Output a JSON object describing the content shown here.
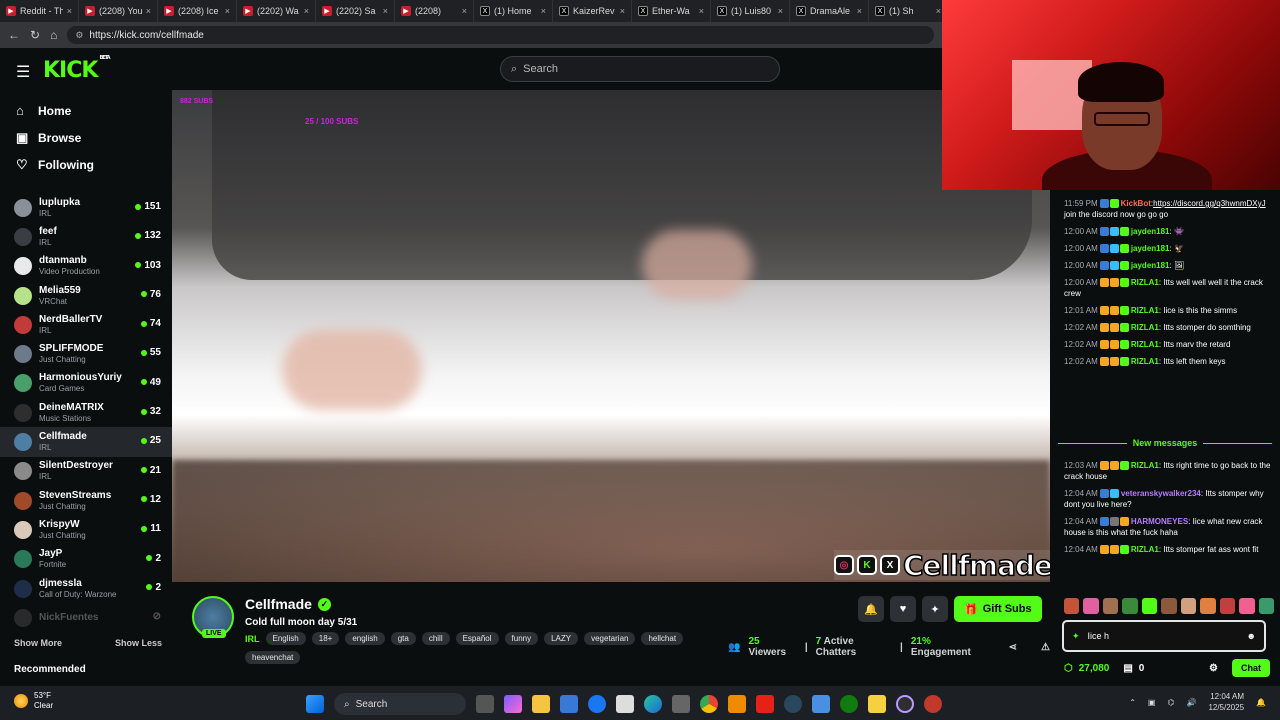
{
  "browser": {
    "tabs": [
      {
        "label": "Reddit - Th",
        "icon": "reddit-icon"
      },
      {
        "label": "(2208) You",
        "icon": "youtube-icon"
      },
      {
        "label": "(2208) Ice",
        "icon": "youtube-icon"
      },
      {
        "label": "(2202) Wa",
        "icon": "youtube-icon"
      },
      {
        "label": "(2202) Sa",
        "icon": "youtube-icon"
      },
      {
        "label": "(2208)",
        "icon": "youtube-icon"
      },
      {
        "label": "(1) Home",
        "icon": "x-icon"
      },
      {
        "label": "KaizerRev",
        "icon": "x-icon"
      },
      {
        "label": "Ether-Wa",
        "icon": "x-icon"
      },
      {
        "label": "(1) Luis80",
        "icon": "x-icon"
      },
      {
        "label": "DramaAle",
        "icon": "x-icon"
      },
      {
        "label": "(1) Sh",
        "icon": "x-icon"
      }
    ],
    "url": "https://kick.com/cellfmade"
  },
  "header": {
    "logo": "KICK",
    "logo_badge": "BETA",
    "search_placeholder": "Search"
  },
  "sidebar": {
    "nav": [
      {
        "label": "Home",
        "icon": "home-icon",
        "glyph": "⌂"
      },
      {
        "label": "Browse",
        "icon": "browse-icon",
        "glyph": "▣"
      },
      {
        "label": "Following",
        "icon": "heart-icon",
        "glyph": "♡"
      }
    ],
    "channels": [
      {
        "name": "luplupka",
        "category": "IRL",
        "viewers": "151",
        "color": "#8a8f9a"
      },
      {
        "name": "feef",
        "category": "IRL",
        "viewers": "132",
        "color": "#3a3d44"
      },
      {
        "name": "dtanmanb",
        "category": "Video Production",
        "viewers": "103",
        "color": "#e9e9e9"
      },
      {
        "name": "Melia559",
        "category": "VRChat",
        "viewers": "76",
        "color": "#b6e38a"
      },
      {
        "name": "NerdBallerTV",
        "category": "IRL",
        "viewers": "74",
        "color": "#c23b3b"
      },
      {
        "name": "SPLIFFMODE",
        "category": "Just Chatting",
        "viewers": "55",
        "color": "#6c7a8a"
      },
      {
        "name": "HarmoniousYuriy",
        "category": "Card Games",
        "viewers": "49",
        "color": "#4a9e6b"
      },
      {
        "name": "DeineMATRIX",
        "category": "Music Stations",
        "viewers": "32",
        "color": "#2e2e2e"
      },
      {
        "name": "Cellfmade",
        "category": "IRL",
        "viewers": "25",
        "color": "#4e7ea3"
      },
      {
        "name": "SilentDestroyer",
        "category": "IRL",
        "viewers": "21",
        "color": "#8a8a8a"
      },
      {
        "name": "StevenStreams",
        "category": "Just Chatting",
        "viewers": "12",
        "color": "#a04a2a"
      },
      {
        "name": "KrispyW",
        "category": "Just Chatting",
        "viewers": "11",
        "color": "#d9c9b9"
      },
      {
        "name": "JayP",
        "category": "Fortnite",
        "viewers": "2",
        "color": "#2a7a5a"
      },
      {
        "name": "djmessla",
        "category": "Call of Duty: Warzone",
        "viewers": "2",
        "color": "#1e2d4a"
      },
      {
        "name": "NickFuentes",
        "category": "",
        "viewers": "",
        "color": "#555555"
      }
    ],
    "show_more": "Show More",
    "show_less": "Show Less",
    "recommended": "Recommended"
  },
  "video": {
    "overlay_top": "882 SUBS",
    "overlay_goal": "25 / 100 SUBS",
    "watermark": "Cellfmade"
  },
  "stream": {
    "name": "Cellfmade",
    "live_label": "LIVE",
    "title": "Cold full moon day 5/31",
    "category": "IRL",
    "tags": [
      "English",
      "18+",
      "english",
      "gta",
      "chill",
      "Español",
      "funny",
      "LAZY",
      "vegetarian",
      "hellchat",
      "heavenchat"
    ],
    "gift_label": "Gift Subs",
    "viewers": "25",
    "viewers_label": "Viewers",
    "chatters": "7",
    "chatters_label": "Active Chatters",
    "engagement": "21%",
    "engagement_label": "Engagement"
  },
  "chat": {
    "messages": [
      {
        "time": "11:59 PM",
        "user": "KickBot",
        "color": "#ff6b57",
        "text": "",
        "link": "https://discord.gg/q3hwnmDXyJ",
        "after": " join the discord now go go go",
        "badges": [
          "#3a7bd5",
          "#53fc18"
        ]
      },
      {
        "time": "12:00 AM",
        "user": "jayden181",
        "color": "#53fc18",
        "text": " 👾",
        "badges": [
          "#3a7bd5",
          "#38bdf8",
          "#53fc18"
        ]
      },
      {
        "time": "12:00 AM",
        "user": "jayden181",
        "color": "#53fc18",
        "text": " 🦅",
        "badges": [
          "#3a7bd5",
          "#38bdf8",
          "#53fc18"
        ]
      },
      {
        "time": "12:00 AM",
        "user": "jayden181",
        "color": "#53fc18",
        "text": " 🖼",
        "badges": [
          "#3a7bd5",
          "#38bdf8",
          "#53fc18"
        ]
      },
      {
        "time": "12:00 AM",
        "user": "RIZLA1",
        "color": "#53fc18",
        "text": " Itts well well well it the crack crew",
        "badges": [
          "#f5a623",
          "#f5a623",
          "#53fc18"
        ]
      },
      {
        "time": "12:01 AM",
        "user": "RIZLA1",
        "color": "#53fc18",
        "text": " Iice is this the simms",
        "badges": [
          "#f5a623",
          "#f5a623",
          "#53fc18"
        ]
      },
      {
        "time": "12:02 AM",
        "user": "RIZLA1",
        "color": "#53fc18",
        "text": " Itts stomper do somthing",
        "badges": [
          "#f5a623",
          "#f5a623",
          "#53fc18"
        ]
      },
      {
        "time": "12:02 AM",
        "user": "RIZLA1",
        "color": "#53fc18",
        "text": " Itts marv the retard",
        "badges": [
          "#f5a623",
          "#f5a623",
          "#53fc18"
        ]
      },
      {
        "time": "12:02 AM",
        "user": "RIZLA1",
        "color": "#53fc18",
        "text": " Itts left them keys",
        "badges": [
          "#f5a623",
          "#f5a623",
          "#53fc18"
        ]
      }
    ],
    "new_messages_label": "New messages",
    "new_messages": [
      {
        "time": "12:03 AM",
        "user": "RIZLA1",
        "color": "#53fc18",
        "text": " Itts right time to go back to the crack house",
        "badges": [
          "#f5a623",
          "#f5a623",
          "#53fc18"
        ]
      },
      {
        "time": "12:04 AM",
        "user": "veteranskywalker234",
        "color": "#b67bff",
        "text": " Itts stomper why dont you live here?",
        "badges": [
          "#3a7bd5",
          "#38bdf8"
        ]
      },
      {
        "time": "12:04 AM",
        "user": "HARMONEYES",
        "color": "#b67bff",
        "text": " Iice what new crack house is this what the fuck haha",
        "badges": [
          "#3a7bd5",
          "#777777",
          "#f5a623"
        ]
      },
      {
        "time": "12:04 AM",
        "user": "RIZLA1",
        "color": "#53fc18",
        "text": " Itts stomper fat ass wont fit",
        "badges": [
          "#f5a623",
          "#f5a623",
          "#53fc18"
        ]
      }
    ],
    "emotes": [
      "#c2543a",
      "#e060a0",
      "#a07050",
      "#3a8a3a",
      "#53fc18",
      "#8a5a3a",
      "#d0a080",
      "#e08040",
      "#c04040",
      "#f06090",
      "#3a9a6a"
    ],
    "input_value": "Iice h",
    "points": "27,080",
    "gifts": "0",
    "send_label": "Chat"
  },
  "taskbar": {
    "temp": "53°F",
    "condition": "Clear",
    "search_placeholder": "Search",
    "time": "12:04 AM",
    "date": "12/5/2025"
  }
}
